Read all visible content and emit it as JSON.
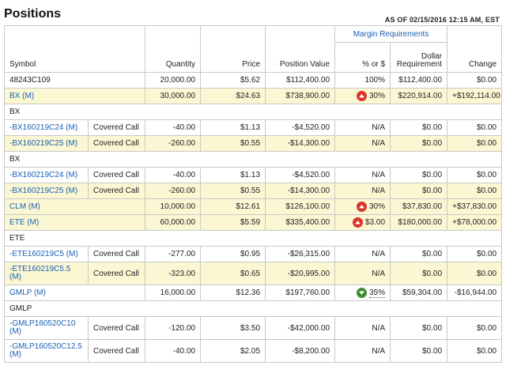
{
  "title": "Positions",
  "as_of": "AS OF 02/15/2016 12:15 AM, EST",
  "colors": {
    "link": "#1a5fb4",
    "row_highlight": "#fbf7d3",
    "up_indicator": "#d9352b",
    "down_indicator": "#3e8c31"
  },
  "columns": {
    "symbol": "Symbol",
    "quantity": "Quantity",
    "price": "Price",
    "position_value": "Position Value",
    "margin_group": "Margin Requirements",
    "pct_or_dollar": "% or $",
    "dollar_req": "Dollar Requirement",
    "change": "Change"
  },
  "rows": [
    {
      "sym": "48243C109",
      "type": "",
      "qty": "20,000.00",
      "price": "$5.62",
      "pv": "$112,400.00",
      "pct": "100%",
      "dreq": "$112,400.00",
      "chg": "$0.00"
    },
    {
      "sym": "BX (M)",
      "type": "",
      "qty": "30,000.00",
      "price": "$24.63",
      "pv": "$738,900.00",
      "pct": "30%",
      "dreq": "$220,914.00",
      "chg": "+$192,114.00"
    },
    {
      "group": "BX"
    },
    {
      "sym": "-BX160219C24 (M)",
      "type": "Covered Call",
      "qty": "-40.00",
      "price": "$1.13",
      "pv": "-$4,520.00",
      "pct": "N/A",
      "dreq": "$0.00",
      "chg": "$0.00"
    },
    {
      "sym": "-BX160219C25 (M)",
      "type": "Covered Call",
      "qty": "-260.00",
      "price": "$0.55",
      "pv": "-$14,300.00",
      "pct": "N/A",
      "dreq": "$0.00",
      "chg": "$0.00"
    },
    {
      "group": "BX"
    },
    {
      "sym": "-BX160219C24 (M)",
      "type": "Covered Call",
      "qty": "-40.00",
      "price": "$1.13",
      "pv": "-$4,520.00",
      "pct": "N/A",
      "dreq": "$0.00",
      "chg": "$0.00"
    },
    {
      "sym": "-BX160219C25 (M)",
      "type": "Covered Call",
      "qty": "-260.00",
      "price": "$0.55",
      "pv": "-$14,300.00",
      "pct": "N/A",
      "dreq": "$0.00",
      "chg": "$0.00"
    },
    {
      "sym": "CLM (M)",
      "type": "",
      "qty": "10,000.00",
      "price": "$12.61",
      "pv": "$126,100.00",
      "pct": "30%",
      "dreq": "$37,830.00",
      "chg": "+$37,830.00"
    },
    {
      "sym": "ETE (M)",
      "type": "",
      "qty": "60,000.00",
      "price": "$5.59",
      "pv": "$335,400.00",
      "pct": "$3.00",
      "dreq": "$180,000.00",
      "chg": "+$78,000.00"
    },
    {
      "group": "ETE"
    },
    {
      "sym": "-ETE160219C5 (M)",
      "type": "Covered Call",
      "qty": "-277.00",
      "price": "$0.95",
      "pv": "-$26,315.00",
      "pct": "N/A",
      "dreq": "$0.00",
      "chg": "$0.00"
    },
    {
      "sym": "-ETE160219C5.5 (M)",
      "type": "Covered Call",
      "qty": "-323.00",
      "price": "$0.65",
      "pv": "-$20,995.00",
      "pct": "N/A",
      "dreq": "$0.00",
      "chg": "$0.00"
    },
    {
      "sym": "GMLP (M)",
      "type": "",
      "qty": "16,000.00",
      "price": "$12.36",
      "pv": "$197,760.00",
      "pct": "35%",
      "dreq": "$59,304.00",
      "chg": "-$16,944.00"
    },
    {
      "group": "GMLP"
    },
    {
      "sym": "-GMLP160520C10 (M)",
      "type": "Covered Call",
      "qty": "-120.00",
      "price": "$3.50",
      "pv": "-$42,000.00",
      "pct": "N/A",
      "dreq": "$0.00",
      "chg": "$0.00"
    },
    {
      "sym": "-GMLP160520C12.5 (M)",
      "type": "Covered Call",
      "qty": "-40.00",
      "price": "$2.05",
      "pv": "-$8,200.00",
      "pct": "N/A",
      "dreq": "$0.00",
      "chg": "$0.00"
    }
  ]
}
